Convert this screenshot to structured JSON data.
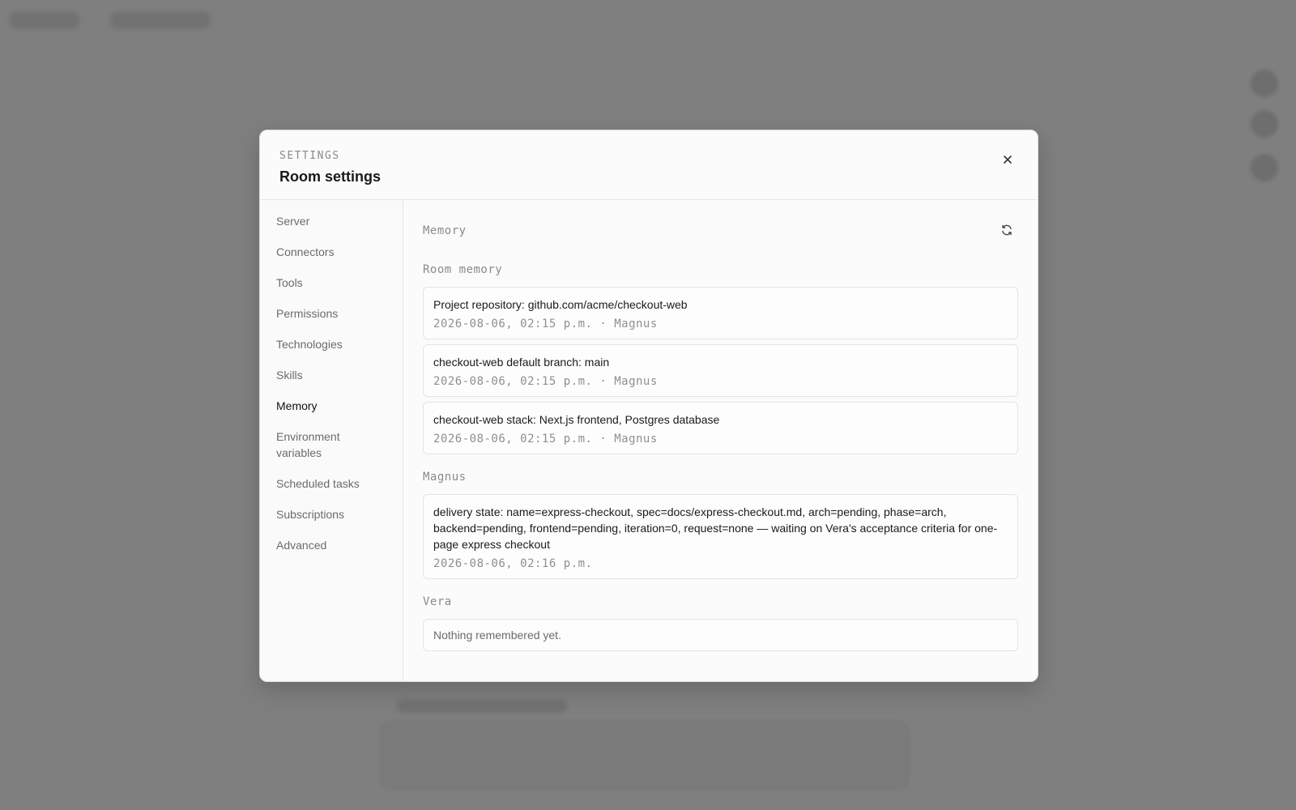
{
  "modal": {
    "eyebrow": "SETTINGS",
    "title": "Room settings",
    "close_icon": "close-icon"
  },
  "sidebar": {
    "items": [
      {
        "label": "Server",
        "active": false
      },
      {
        "label": "Connectors",
        "active": false
      },
      {
        "label": "Tools",
        "active": false
      },
      {
        "label": "Permissions",
        "active": false
      },
      {
        "label": "Technologies",
        "active": false
      },
      {
        "label": "Skills",
        "active": false
      },
      {
        "label": "Memory",
        "active": true
      },
      {
        "label": "Environment variables",
        "active": false
      },
      {
        "label": "Scheduled tasks",
        "active": false
      },
      {
        "label": "Subscriptions",
        "active": false
      },
      {
        "label": "Advanced",
        "active": false
      }
    ]
  },
  "content": {
    "heading": "Memory",
    "refresh_icon": "refresh-icon",
    "groups": [
      {
        "title": "Room memory",
        "entries": [
          {
            "text": "Project repository: github.com/acme/checkout-web",
            "meta": "2026-08-06, 02:15 p.m. · Magnus"
          },
          {
            "text": "checkout-web default branch: main",
            "meta": "2026-08-06, 02:15 p.m. · Magnus"
          },
          {
            "text": "checkout-web stack: Next.js frontend, Postgres database",
            "meta": "2026-08-06, 02:15 p.m. · Magnus"
          }
        ]
      },
      {
        "title": "Magnus",
        "entries": [
          {
            "text": "delivery state: name=express-checkout, spec=docs/express-checkout.md, arch=pending, phase=arch, backend=pending, frontend=pending, iteration=0, request=none — waiting on Vera's acceptance criteria for one-page express checkout",
            "meta": "2026-08-06, 02:16 p.m."
          }
        ]
      },
      {
        "title": "Vera",
        "empty_text": "Nothing remembered yet."
      }
    ]
  },
  "colors": {
    "overlay": "#808080",
    "modal_bg": "#fbfbfb",
    "active_nav": "#111111",
    "muted_text": "#8a8a8a"
  }
}
